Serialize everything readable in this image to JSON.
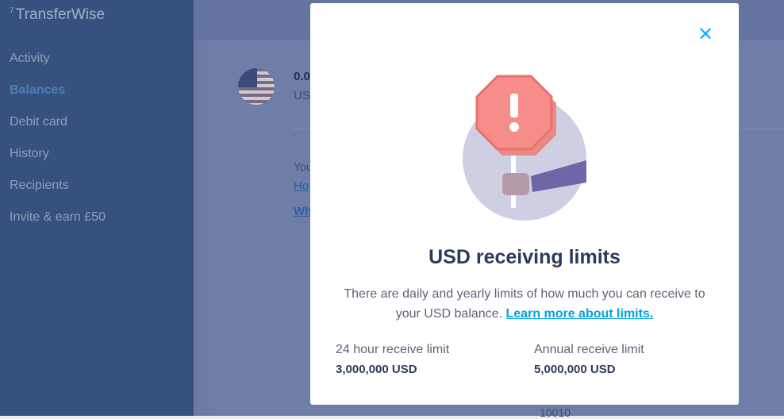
{
  "app": {
    "name": "TransferWise"
  },
  "sidebar": {
    "items": [
      {
        "label": "Activity",
        "active": false
      },
      {
        "label": "Balances",
        "active": true
      },
      {
        "label": "Debit card",
        "active": false
      },
      {
        "label": "History",
        "active": false
      },
      {
        "label": "Recipients",
        "active": false
      },
      {
        "label": "Invite & earn £50",
        "active": false
      }
    ]
  },
  "background_card": {
    "balance_amount": "0.0",
    "balance_currency": "US",
    "text_fragment": "You",
    "link_fragment_1": "Ho",
    "link_fragment_2": "Wh",
    "number_fragment": "10010"
  },
  "modal": {
    "close_icon": "close-icon",
    "title": "USD receiving limits",
    "description": "There are daily and yearly limits of how much you can receive to your USD balance.",
    "learn_more_link": "Learn more about limits.",
    "limits": [
      {
        "label": "24 hour receive limit",
        "value": "3,000,000 USD"
      },
      {
        "label": "Annual receive limit",
        "value": "5,000,000 USD"
      }
    ]
  },
  "colors": {
    "accent": "#00b9ff",
    "title": "#2e3a5c",
    "stop_sign": "#f78d8a",
    "circle": "#cfcfe3",
    "sleeve": "#6e66a6",
    "sidebar": "#37517e"
  }
}
